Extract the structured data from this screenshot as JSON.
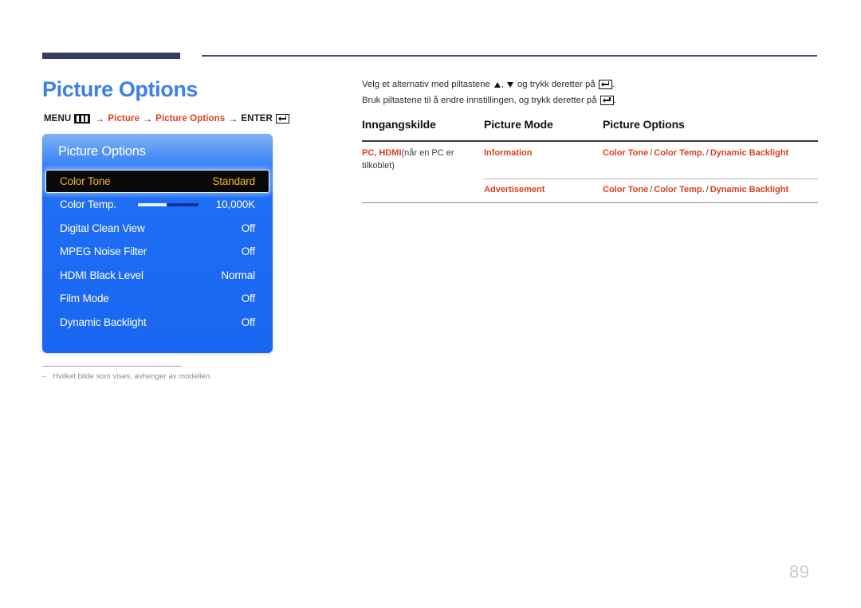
{
  "page": {
    "title": "Picture Options",
    "number": "89"
  },
  "breadcrumb": {
    "menu_label": "MENU",
    "menu_icon": "menu-bars-icon",
    "arrow": "→",
    "item_1": "Picture",
    "item_2": "Picture Options",
    "enter_label": "ENTER",
    "enter_icon": "enter-key-icon"
  },
  "osd": {
    "title": "Picture Options",
    "rows": [
      {
        "label": "Color Tone",
        "value": "Standard",
        "selected": true,
        "control": "none"
      },
      {
        "label": "Color Temp.",
        "value": "10,000K",
        "selected": false,
        "control": "slider",
        "slider_fill_percent": 47
      },
      {
        "label": "Digital Clean View",
        "value": "Off",
        "selected": false,
        "control": "none"
      },
      {
        "label": "MPEG Noise Filter",
        "value": "Off",
        "selected": false,
        "control": "none"
      },
      {
        "label": "HDMI Black Level",
        "value": "Normal",
        "selected": false,
        "control": "none"
      },
      {
        "label": "Film Mode",
        "value": "Off",
        "selected": false,
        "control": "none"
      },
      {
        "label": "Dynamic Backlight",
        "value": "Off",
        "selected": false,
        "control": "none"
      }
    ]
  },
  "footnote": {
    "dash": "–",
    "text": "Hvilket bilde som vises, avhenger av modellen."
  },
  "instructions": {
    "line1_part1": "Velg et alternativ med piltastene",
    "line1_part2": ",",
    "line1_part3": "og trykk deretter på",
    "line1_end": ".",
    "line2_text": "Bruk piltastene til å endre innstillingen, og trykk deretter på",
    "line2_end": ".",
    "arrow_up_icon": "triangle-up-icon",
    "arrow_down_icon": "triangle-down-icon",
    "enter_icon": "enter-key-icon"
  },
  "table": {
    "headers": [
      "Inngangskilde",
      "Picture Mode",
      "Picture Options"
    ],
    "rows": [
      {
        "source_strong": "PC, HDMI",
        "source_plain": "(når en PC er tilkoblet)",
        "mode": "Information",
        "options": [
          "Color Tone",
          "Color Temp.",
          "Dynamic Backlight"
        ],
        "separator": "/"
      },
      {
        "source_strong": "",
        "source_plain": "",
        "mode": "Advertisement",
        "options": [
          "Color Tone",
          "Color Temp.",
          "Dynamic Backlight"
        ],
        "separator": "/"
      }
    ]
  },
  "colors": {
    "accent_blue": "#3e7fe8",
    "accent_red": "#d9401f",
    "osd_blue": "#1a66f2",
    "osd_highlight_text": "#f5b430",
    "rule_navy": "#373b5e",
    "page_number_gray": "#c9c9d2"
  }
}
